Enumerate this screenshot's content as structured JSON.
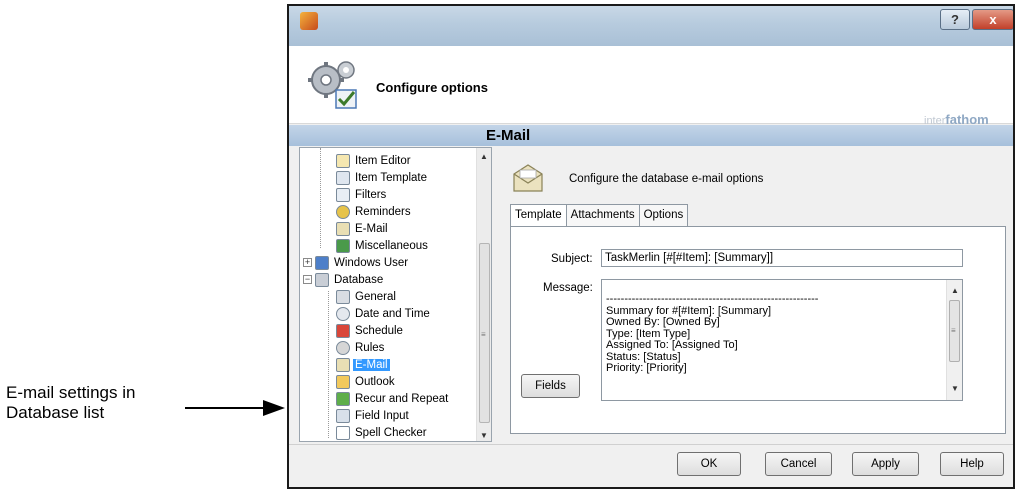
{
  "callout": {
    "line1": "E-mail settings in",
    "line2": "Database list"
  },
  "window": {
    "help_button": "?",
    "close_button": "x"
  },
  "banner": {
    "title": "Configure options",
    "brand_prefix": "inter",
    "brand_name": "fathom"
  },
  "section": {
    "title": "E-Mail"
  },
  "tree": {
    "items": [
      {
        "label": "Item Editor",
        "icon": "editor-icon"
      },
      {
        "label": "Item Template",
        "icon": "template-icon"
      },
      {
        "label": "Filters",
        "icon": "filter-icon"
      },
      {
        "label": "Reminders",
        "icon": "bell-icon"
      },
      {
        "label": "E-Mail",
        "icon": "envelope-icon"
      },
      {
        "label": "Miscellaneous",
        "icon": "shapes-icon"
      },
      {
        "label": "Windows User",
        "icon": "user-icon"
      },
      {
        "label": "Database",
        "icon": "database-icon"
      },
      {
        "label": "General",
        "icon": "general-icon"
      },
      {
        "label": "Date and Time",
        "icon": "clock-icon"
      },
      {
        "label": "Schedule",
        "icon": "calendar-icon"
      },
      {
        "label": "Rules",
        "icon": "rules-icon"
      },
      {
        "label": "E-Mail",
        "icon": "envelope-icon"
      },
      {
        "label": "Outlook",
        "icon": "outlook-icon"
      },
      {
        "label": "Recur and Repeat",
        "icon": "recur-icon"
      },
      {
        "label": "Field Input",
        "icon": "field-input-icon"
      },
      {
        "label": "Spell Checker",
        "icon": "spell-check-icon"
      }
    ],
    "selected": "E-Mail (Database)"
  },
  "page": {
    "description": "Configure the database e-mail options"
  },
  "tabs": [
    {
      "label": "Template",
      "active": true
    },
    {
      "label": "Attachments",
      "active": false
    },
    {
      "label": "Options",
      "active": false
    }
  ],
  "form": {
    "subject_label": "Subject:",
    "subject_value": "TaskMerlin [#[#Item]: [Summary]]",
    "message_label": "Message:",
    "message_lines": [
      "----------------------------------------------------------",
      "Summary for #[#Item]: [Summary]",
      "Owned By: [Owned By]",
      "Type: [Item Type]",
      "Assigned To: [Assigned To]",
      "Status: [Status]",
      "Priority: [Priority]"
    ],
    "fields_button": "Fields"
  },
  "footer": {
    "ok": "OK",
    "cancel": "Cancel",
    "apply": "Apply",
    "help": "Help"
  },
  "colors": {
    "selection": "#3399ff",
    "section_header": "#a6c0db",
    "close_button": "#c2402a"
  }
}
